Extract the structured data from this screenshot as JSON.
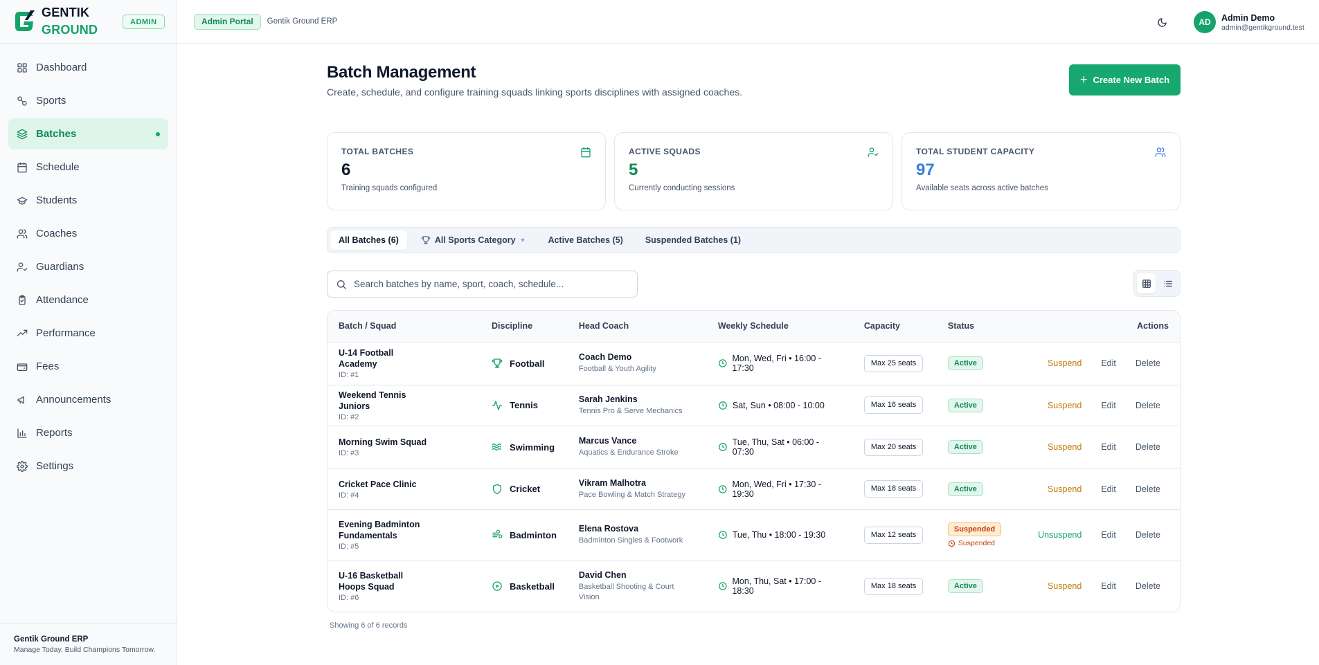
{
  "brand": {
    "line1": "GENTIK",
    "line2": "GROUND",
    "role_badge": "ADMIN"
  },
  "nav": [
    {
      "label": "Dashboard",
      "icon": "grid-icon",
      "active": false
    },
    {
      "label": "Sports",
      "icon": "sports-icon",
      "active": false
    },
    {
      "label": "Batches",
      "icon": "layers-icon",
      "active": true
    },
    {
      "label": "Schedule",
      "icon": "calendar-icon",
      "active": false
    },
    {
      "label": "Students",
      "icon": "graduation-cap-icon",
      "active": false
    },
    {
      "label": "Coaches",
      "icon": "users-icon",
      "active": false
    },
    {
      "label": "Guardians",
      "icon": "user-check-icon",
      "active": false
    },
    {
      "label": "Attendance",
      "icon": "clipboard-check-icon",
      "active": false
    },
    {
      "label": "Performance",
      "icon": "trending-up-icon",
      "active": false
    },
    {
      "label": "Fees",
      "icon": "wallet-icon",
      "active": false
    },
    {
      "label": "Announcements",
      "icon": "megaphone-icon",
      "active": false
    },
    {
      "label": "Reports",
      "icon": "bar-chart-icon",
      "active": false
    },
    {
      "label": "Settings",
      "icon": "gear-icon",
      "active": false
    }
  ],
  "footer": {
    "title": "Gentik Ground ERP",
    "tagline": "Manage Today. Build Champions Tomorrow."
  },
  "topbar": {
    "portal_badge": "Admin Portal",
    "portal_sub": "Gentik Ground ERP",
    "user_initials": "AD",
    "user_name": "Admin Demo",
    "user_email": "admin@gentikground.test"
  },
  "page": {
    "title": "Batch Management",
    "subtitle": "Create, schedule, and configure training squads linking sports disciplines with assigned coaches.",
    "create_label": "Create New Batch"
  },
  "stats": [
    {
      "label": "TOTAL BATCHES",
      "value": "6",
      "desc": "Training squads configured",
      "color": "#0f172a",
      "icon": "calendar-icon"
    },
    {
      "label": "ACTIVE SQUADS",
      "value": "5",
      "desc": "Currently conducting sessions",
      "color": "#0f8a56",
      "icon": "user-check-icon"
    },
    {
      "label": "TOTAL STUDENT CAPACITY",
      "value": "97",
      "desc": "Available seats across active batches",
      "color": "#3b7dd8",
      "icon": "users-icon"
    }
  ],
  "filters": {
    "all": "All Batches (6)",
    "sport": "All Sports Category",
    "active": "Active Batches (5)",
    "suspended": "Suspended Batches (1)"
  },
  "search": {
    "placeholder": "Search batches by name, sport, coach, schedule..."
  },
  "table": {
    "headers": [
      "Batch / Squad",
      "Discipline",
      "Head Coach",
      "Weekly Schedule",
      "Capacity",
      "Status",
      "Actions"
    ],
    "rows": [
      {
        "name": "U-14 Football Academy",
        "id": "ID: #1",
        "discipline": "Football",
        "dicon": "trophy-icon",
        "coach": "Coach Demo",
        "spec": "Football & Youth Agility",
        "schedule": "Mon, Wed, Fri • 16:00 - 17:30",
        "capacity": "Max 25 seats",
        "status": "Active",
        "status_type": "active",
        "toggle": "Suspend"
      },
      {
        "name": "Weekend Tennis Juniors",
        "id": "ID: #2",
        "discipline": "Tennis",
        "dicon": "activity-icon",
        "coach": "Sarah Jenkins",
        "spec": "Tennis Pro & Serve Mechanics",
        "schedule": "Sat, Sun • 08:00 - 10:00",
        "capacity": "Max 16 seats",
        "status": "Active",
        "status_type": "active",
        "toggle": "Suspend"
      },
      {
        "name": "Morning Swim Squad",
        "id": "ID: #3",
        "discipline": "Swimming",
        "dicon": "waves-icon",
        "coach": "Marcus Vance",
        "spec": "Aquatics & Endurance Stroke",
        "schedule": "Tue, Thu, Sat • 06:00 - 07:30",
        "capacity": "Max 20 seats",
        "status": "Active",
        "status_type": "active",
        "toggle": "Suspend"
      },
      {
        "name": "Cricket Pace Clinic",
        "id": "ID: #4",
        "discipline": "Cricket",
        "dicon": "shield-icon",
        "coach": "Vikram Malhotra",
        "spec": "Pace Bowling & Match Strategy",
        "schedule": "Mon, Wed, Fri • 17:30 - 19:30",
        "capacity": "Max 18 seats",
        "status": "Active",
        "status_type": "active",
        "toggle": "Suspend"
      },
      {
        "name": "Evening Badminton Fundamentals",
        "id": "ID: #5",
        "discipline": "Badminton",
        "dicon": "wind-icon",
        "coach": "Elena Rostova",
        "spec": "Badminton Singles & Footwork",
        "schedule": "Tue, Thu • 18:00 - 19:30",
        "capacity": "Max 12 seats",
        "status": "Suspended",
        "status_type": "suspended",
        "note": "Suspended",
        "toggle": "Unsuspend"
      },
      {
        "name": "U-16 Basketball Hoops Squad",
        "id": "ID: #6",
        "discipline": "Basketball",
        "dicon": "target-icon",
        "coach": "David Chen",
        "spec": "Basketball Shooting & Court Vision",
        "schedule": "Mon, Thu, Sat • 17:00 - 18:30",
        "capacity": "Max 18 seats",
        "status": "Active",
        "status_type": "active",
        "toggle": "Suspend"
      }
    ],
    "edit_label": "Edit",
    "delete_label": "Delete"
  },
  "records": "Showing 6 of 6 records",
  "colors": {
    "brand": "#16a36b",
    "accent_blue": "#3b7dd8",
    "warning": "#c27a0a"
  }
}
